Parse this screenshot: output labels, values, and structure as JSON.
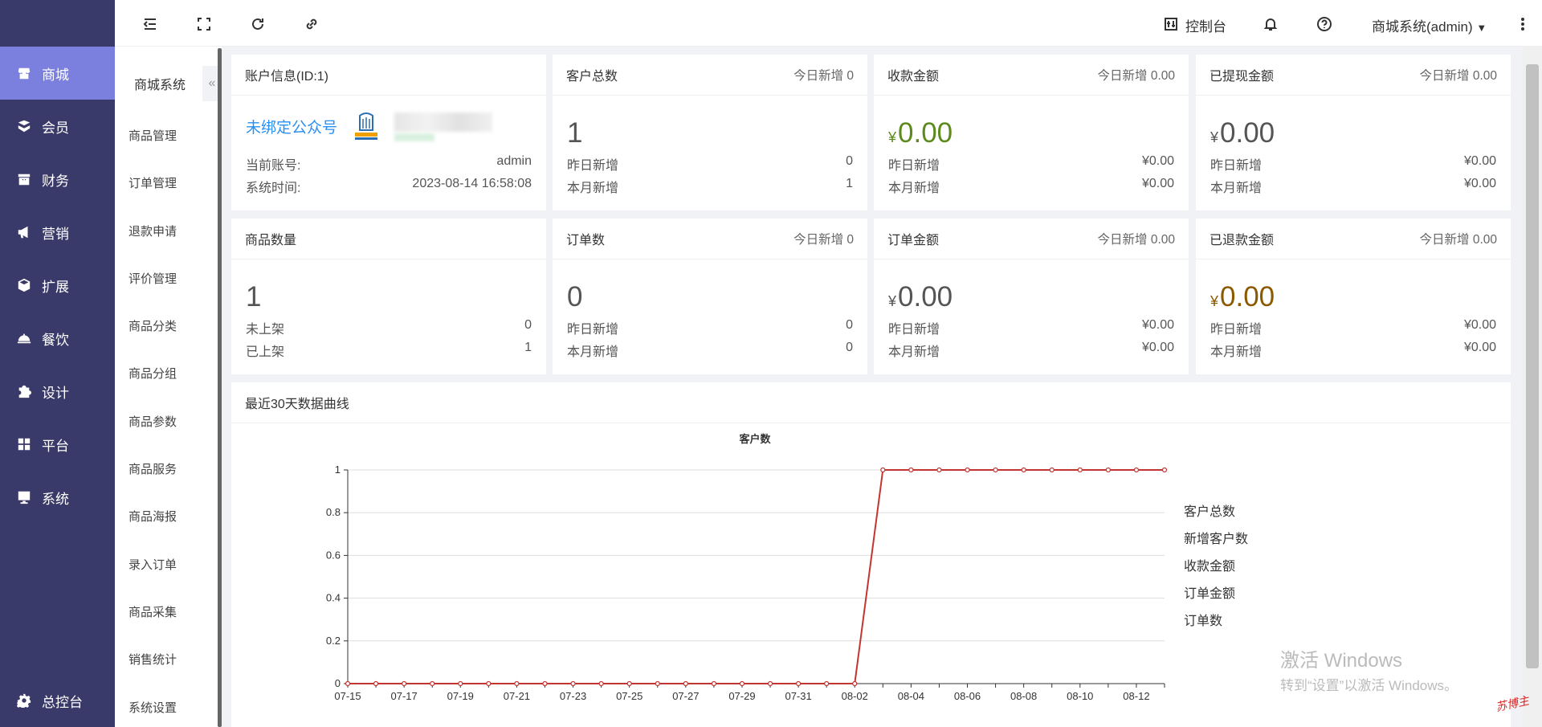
{
  "leftnav": {
    "items": [
      {
        "label": "商城",
        "icon": "store-icon",
        "active": true
      },
      {
        "label": "会员",
        "icon": "member-icon"
      },
      {
        "label": "财务",
        "icon": "finance-icon"
      },
      {
        "label": "营销",
        "icon": "megaphone-icon"
      },
      {
        "label": "扩展",
        "icon": "cube-icon"
      },
      {
        "label": "餐饮",
        "icon": "dining-icon"
      },
      {
        "label": "设计",
        "icon": "puzzle-icon"
      },
      {
        "label": "平台",
        "icon": "grid-icon"
      },
      {
        "label": "系统",
        "icon": "monitor-icon"
      }
    ],
    "bottom": {
      "label": "总控台",
      "icon": "gear-icon"
    }
  },
  "subnav": {
    "title": "商城系统",
    "collapse_icon": "«",
    "items": [
      "商品管理",
      "订单管理",
      "退款申请",
      "评价管理",
      "商品分类",
      "商品分组",
      "商品参数",
      "商品服务",
      "商品海报",
      "录入订单",
      "商品采集",
      "销售统计",
      "系统设置"
    ]
  },
  "topbar": {
    "console_label": "控制台",
    "user_label": "商城系统(admin)"
  },
  "account": {
    "title": "账户信息(ID:1)",
    "wechat_link": "未绑定公众号",
    "account_label": "当前账号:",
    "account_value": "admin",
    "time_label": "系统时间:",
    "time_value": "2023-08-14 16:58:08"
  },
  "stats": {
    "customers": {
      "title": "客户总数",
      "today": "今日新增 0",
      "value": "1",
      "r1_label": "昨日新增",
      "r1_value": "0",
      "r2_label": "本月新增",
      "r2_value": "1"
    },
    "receipts": {
      "title": "收款金额",
      "today": "今日新增 0.00",
      "yen": "¥",
      "value": "0.00",
      "r1_label": "昨日新增",
      "r1_value": "¥0.00",
      "r2_label": "本月新增",
      "r2_value": "¥0.00"
    },
    "withdrawn": {
      "title": "已提现金额",
      "today": "今日新增 0.00",
      "yen": "¥",
      "value": "0.00",
      "r1_label": "昨日新增",
      "r1_value": "¥0.00",
      "r2_label": "本月新增",
      "r2_value": "¥0.00"
    },
    "products": {
      "title": "商品数量",
      "value": "1",
      "r1_label": "未上架",
      "r1_value": "0",
      "r2_label": "已上架",
      "r2_value": "1"
    },
    "orders": {
      "title": "订单数",
      "today": "今日新增 0",
      "value": "0",
      "r1_label": "昨日新增",
      "r1_value": "0",
      "r2_label": "本月新增",
      "r2_value": "0"
    },
    "order_amount": {
      "title": "订单金额",
      "today": "今日新增 0.00",
      "yen": "¥",
      "value": "0.00",
      "r1_label": "昨日新增",
      "r1_value": "¥0.00",
      "r2_label": "本月新增",
      "r2_value": "¥0.00"
    },
    "refunded": {
      "title": "已退款金额",
      "today": "今日新增 0.00",
      "yen": "¥",
      "value": "0.00",
      "r1_label": "昨日新增",
      "r1_value": "¥0.00",
      "r2_label": "本月新增",
      "r2_value": "¥0.00"
    }
  },
  "chart_section_title": "最近30天数据曲线",
  "chart_data": {
    "type": "line",
    "title": "客户数",
    "x": [
      "07-15",
      "07-16",
      "07-17",
      "07-18",
      "07-19",
      "07-20",
      "07-21",
      "07-22",
      "07-23",
      "07-24",
      "07-25",
      "07-26",
      "07-27",
      "07-28",
      "07-29",
      "07-30",
      "07-31",
      "08-01",
      "08-02",
      "08-03",
      "08-04",
      "08-05",
      "08-06",
      "08-07",
      "08-08",
      "08-09",
      "08-10",
      "08-11",
      "08-12",
      "08-13"
    ],
    "x_tick_labels": [
      "07-15",
      "07-17",
      "07-19",
      "07-21",
      "07-23",
      "07-25",
      "07-27",
      "07-29",
      "07-31",
      "08-02",
      "08-04",
      "08-06",
      "08-08",
      "08-10",
      "08-12"
    ],
    "yticks": [
      "0",
      "0.2",
      "0.4",
      "0.6",
      "0.8",
      "1"
    ],
    "ylim": [
      0,
      1
    ],
    "series": [
      {
        "name": "客户总数",
        "values": [
          0,
          0,
          0,
          0,
          0,
          0,
          0,
          0,
          0,
          0,
          0,
          0,
          0,
          0,
          0,
          0,
          0,
          0,
          0,
          1,
          1,
          1,
          1,
          1,
          1,
          1,
          1,
          1,
          1,
          1
        ],
        "color": "#c23531"
      }
    ],
    "legend": [
      "客户总数",
      "新增客户数",
      "收款金额",
      "订单金额",
      "订单数"
    ],
    "legend_position": "right",
    "grid": true
  },
  "watermark": {
    "line1": "激活 Windows",
    "line2": "转到“设置”以激活 Windows。",
    "corner": "苏博主"
  }
}
